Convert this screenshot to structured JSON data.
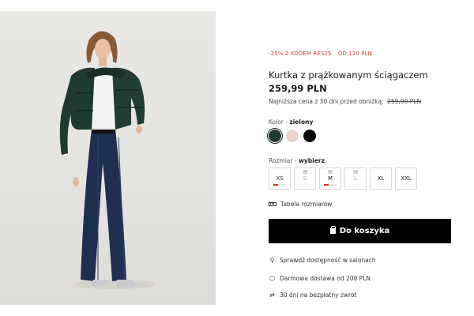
{
  "promo": {
    "discount": "-25% Z KODEM RES25",
    "from": "OD 120 PLN"
  },
  "product": {
    "title": "Kurtka z prążkowanym ściągaczem",
    "price": "259,99 PLN",
    "lowest_label": "Najniższa cena z 30 dni przed obniżką:",
    "lowest_value": "259,99 PLN"
  },
  "color": {
    "label": "Kolor",
    "separator": " - ",
    "selected": "zielony",
    "swatches": [
      "#203a32",
      "#ead3d0",
      "#0a0a0a"
    ]
  },
  "size": {
    "label": "Rozmiar",
    "separator": " - ",
    "prompt": "wybierz",
    "options": [
      "XS",
      "S",
      "M",
      "L",
      "XL",
      "XXL"
    ],
    "low_stock_level": {
      "XS": 0.4,
      "M": 0.4
    },
    "table_label": "Tabela rozmiarów"
  },
  "cart": {
    "button_label": "Do koszyka"
  },
  "features": {
    "stores": "Sprawdź dostępność w salonach",
    "delivery": "Darmowa dostawa od 200 PLN",
    "returns": "30 dni na bezpłatny zwrot"
  },
  "colors": {
    "promo": "#d0423d",
    "button": "#000000",
    "low_stock": "#d0302b"
  }
}
